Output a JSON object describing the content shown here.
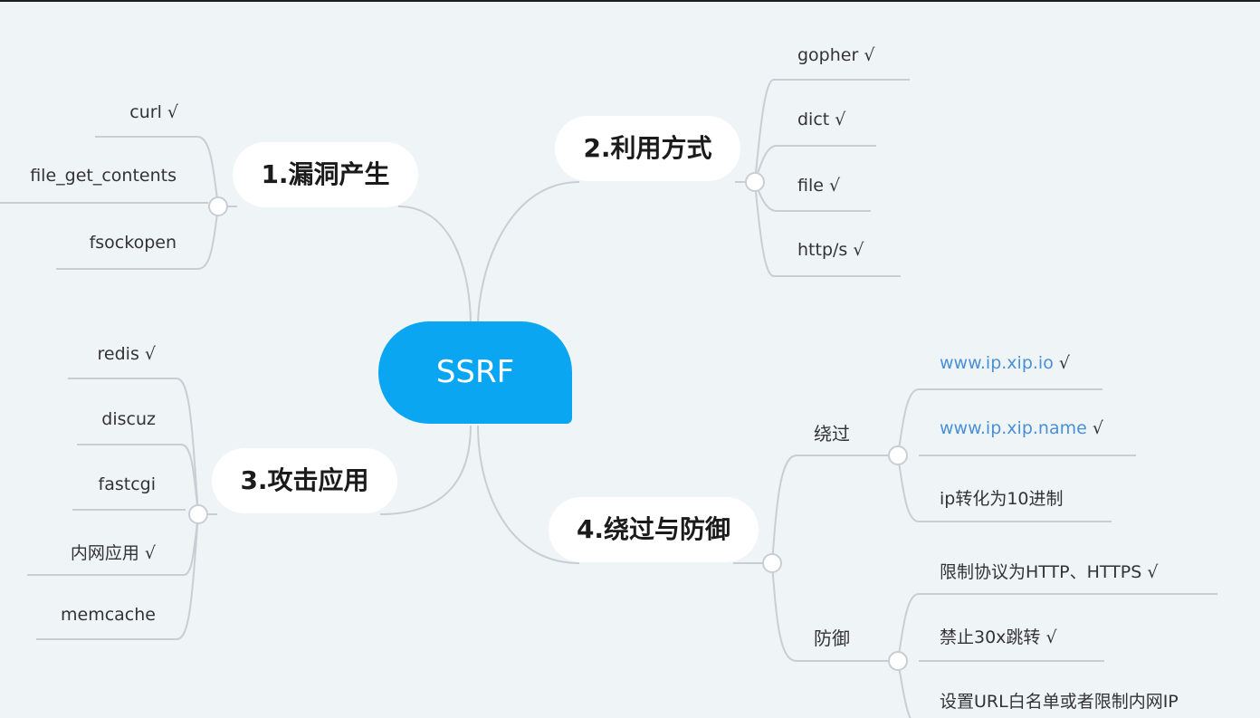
{
  "root": {
    "label": "SSRF"
  },
  "branches": {
    "b1": {
      "label": "1.漏洞产生",
      "items": [
        "curl √",
        "file_get_contents",
        "fsockopen"
      ]
    },
    "b2": {
      "label": "2.利用方式",
      "items": [
        "gopher √",
        "dict √",
        "file √",
        "http/s √"
      ]
    },
    "b3": {
      "label": "3.攻击应用",
      "items": [
        "redis √",
        "discuz",
        "fastcgi",
        "内网应用 √",
        "memcache"
      ]
    },
    "b4": {
      "label": "4.绕过与防御",
      "bypass": {
        "label": "绕过",
        "items": [
          {
            "link": "www.ip.xip.io",
            "mark": " √"
          },
          {
            "link": "www.ip.xip.name",
            "mark": " √"
          },
          {
            "text": "ip转化为10进制"
          }
        ]
      },
      "defense": {
        "label": "防御",
        "items": [
          "限制协议为HTTP、HTTPS √",
          "禁止30x跳转 √",
          "设置URL白名单或者限制内网IP"
        ]
      }
    }
  },
  "colors": {
    "background": "#eff4f7",
    "root": "#0aa6f2",
    "line": "#c8ced3",
    "link": "#4a90d9"
  }
}
